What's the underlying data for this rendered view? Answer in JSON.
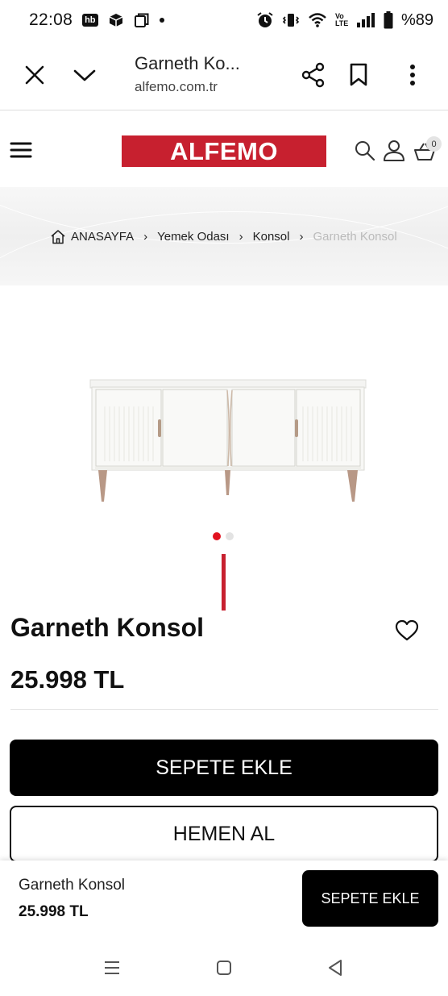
{
  "status_bar": {
    "time": "22:08",
    "app_badge": "hb",
    "battery": "%89",
    "network": "Vo LTE"
  },
  "browser": {
    "page_title": "Garneth Ko...",
    "domain": "alfemo.com.tr"
  },
  "site": {
    "logo_text": "ALFEMO",
    "cart_count": "0",
    "brand_color": "#c7202f"
  },
  "breadcrumb": {
    "items": [
      "ANASAYFA",
      "Yemek Odası",
      "Konsol",
      "Garneth Konsol"
    ]
  },
  "gallery": {
    "image_count": 2,
    "active_index": 0
  },
  "product": {
    "name": "Garneth Konsol",
    "price": "25.998 TL",
    "add_to_cart": "SEPETE EKLE",
    "buy_now": "HEMEN AL"
  },
  "sticky_bar": {
    "name": "Garneth Konsol",
    "price": "25.998 TL",
    "button": "SEPETE EKLE"
  },
  "icons": {
    "close": "close-icon",
    "chevron": "chevron-down-icon",
    "share": "share-icon",
    "bookmark": "bookmark-icon",
    "more": "more-vertical-icon",
    "menu": "hamburger-menu-icon",
    "search": "search-icon",
    "user": "user-icon",
    "cart": "cart-icon",
    "home": "home-icon",
    "heart": "heart-icon"
  }
}
